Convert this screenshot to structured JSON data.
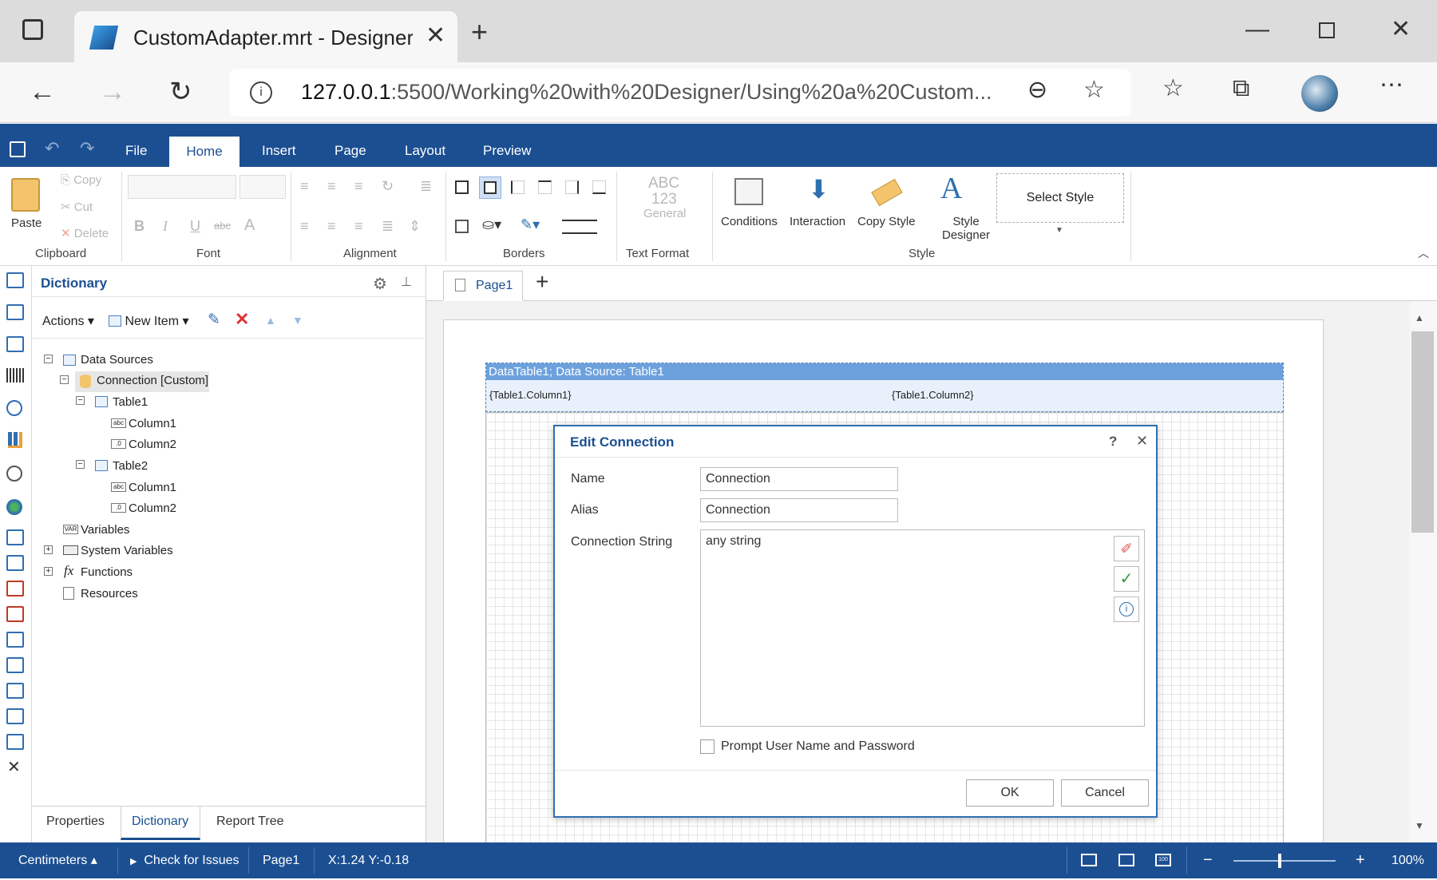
{
  "browser": {
    "tab_title": "CustomAdapter.mrt - Designer [",
    "url_host": "127.0.0.1",
    "url_path": ":5500/Working%20with%20Designer/Using%20a%20Custom..."
  },
  "menu": {
    "file": "File",
    "home": "Home",
    "insert": "Insert",
    "page": "Page",
    "layout": "Layout",
    "preview": "Preview"
  },
  "ribbon": {
    "clipboard": {
      "paste": "Paste",
      "copy": "Copy",
      "cut": "Cut",
      "delete": "Delete",
      "label": "Clipboard"
    },
    "font_label": "Font",
    "alignment_label": "Alignment",
    "borders_label": "Borders",
    "text_format": {
      "abc": "ABC",
      "num": "123",
      "general": "General",
      "label": "Text Format"
    },
    "style": {
      "conditions": "Conditions",
      "interaction": "Interaction",
      "copy_style": "Copy Style",
      "style_designer_1": "Style",
      "style_designer_2": "Designer",
      "select_style": "Select Style",
      "label": "Style"
    }
  },
  "dictionary": {
    "title": "Dictionary",
    "actions": "Actions",
    "new_item": "New Item",
    "tree": {
      "data_sources": "Data Sources",
      "connection": "Connection [Custom]",
      "table1": "Table1",
      "t1_col1": "Column1",
      "t1_col2": "Column2",
      "table2": "Table2",
      "t2_col1": "Column1",
      "t2_col2": "Column2",
      "variables": "Variables",
      "system_variables": "System Variables",
      "functions": "Functions",
      "resources": "Resources"
    },
    "tabs": {
      "properties": "Properties",
      "dictionary": "Dictionary",
      "report_tree": "Report Tree"
    }
  },
  "designer": {
    "page_tab": "Page1",
    "band_header": "DataTable1; Data Source: Table1",
    "cell1": "{Table1.Column1}",
    "cell2": "{Table1.Column2}"
  },
  "dialog": {
    "title": "Edit Connection",
    "help": "?",
    "name_label": "Name",
    "name_value": "Connection",
    "alias_label": "Alias",
    "alias_value": "Connection",
    "connstr_label": "Connection String",
    "connstr_value": "any string",
    "prompt_label": "Prompt User Name and Password",
    "prompt_checked": false,
    "ok": "OK",
    "cancel": "Cancel"
  },
  "statusbar": {
    "units": "Centimeters",
    "check": "Check for Issues",
    "page": "Page1",
    "coords": "X:1.24 Y:-0.18",
    "zoom": "100%",
    "zoom_level": 1.0
  }
}
